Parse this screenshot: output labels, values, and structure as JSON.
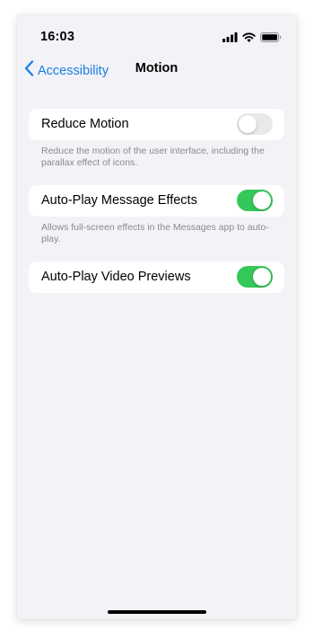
{
  "status_bar": {
    "time": "16:03",
    "signal_icon": "cellular-signal-icon",
    "wifi_icon": "wifi-icon",
    "battery_icon": "battery-icon"
  },
  "nav": {
    "back_label": "Accessibility",
    "back_icon": "chevron-left-icon",
    "title": "Motion"
  },
  "settings": [
    {
      "label": "Reduce Motion",
      "enabled": false,
      "footer": "Reduce the motion of the user interface, including the parallax effect of icons."
    },
    {
      "label": "Auto-Play Message Effects",
      "enabled": true,
      "footer": "Allows full-screen effects in the Messages app to auto-play."
    },
    {
      "label": "Auto-Play Video Previews",
      "enabled": true,
      "footer": ""
    }
  ],
  "colors": {
    "accent": "#1a7ee6",
    "toggle_on": "#34c759",
    "toggle_off": "#e9e9eb",
    "background": "#f2f2f7"
  }
}
